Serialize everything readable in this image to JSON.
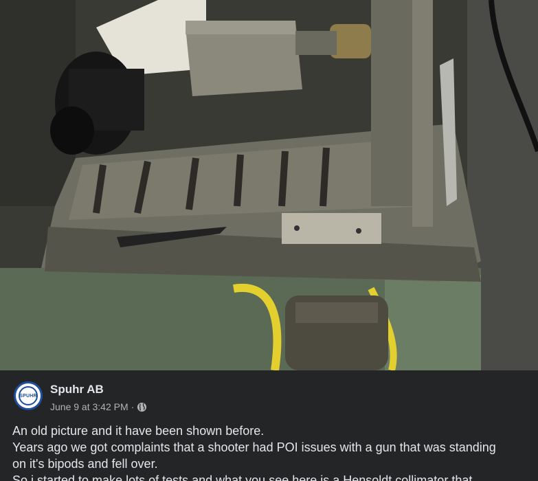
{
  "post": {
    "page_name": "Spuhr AB",
    "avatar_text": "SPUHR",
    "timestamp": "June 9 at 3:42 PM",
    "separator": "·",
    "privacy_icon": "globe-icon",
    "text_lines": [
      "An old picture and it have been shown before.",
      "Years ago we got complaints that a shooter had POI issues with a gun that was standing",
      "on it's bipods and fell over.",
      "So i started to make lots of tests and what you see here is a Hensoldt collimator that"
    ]
  },
  "colors": {
    "background": "#242526",
    "primary_text": "#e4e6eb",
    "secondary_text": "#b0b3b8",
    "avatar_ring": "#1f4e9c"
  }
}
